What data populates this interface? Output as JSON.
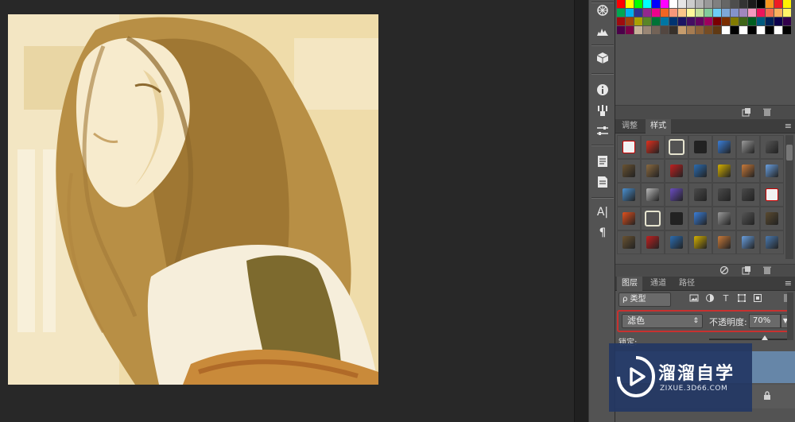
{
  "colors": {
    "app_background": "#282828",
    "panel_background": "#535353",
    "highlight_border": "#c8312f",
    "selected_layer": "#6686a8",
    "watermark_bg": "#233764"
  },
  "toolbar_icons": [
    "color-wheel-icon",
    "histogram-icon",
    "cube-icon",
    "info-icon",
    "brush-icon",
    "sliders-icon",
    "notes-icon",
    "document-icon",
    "character-icon",
    "paragraph-icon"
  ],
  "toolbar_glyphs": {
    "character": "A|",
    "paragraph": "¶"
  },
  "swatches": [
    "#ff0000",
    "#ffff00",
    "#00ff00",
    "#00ffff",
    "#0000ff",
    "#ff00ff",
    "#ffffff",
    "#e6e6e6",
    "#cccccc",
    "#b3b3b3",
    "#999999",
    "#808080",
    "#666666",
    "#4d4d4d",
    "#333333",
    "#1a1a1a",
    "#000000",
    "#f7941d",
    "#ed1c24",
    "#fff200",
    "#00a651",
    "#00aeef",
    "#2e3192",
    "#92278f",
    "#ec008c",
    "#f26522",
    "#f7977a",
    "#fdc689",
    "#fff799",
    "#c4df9b",
    "#82ca9c",
    "#6dcff6",
    "#7ea7d8",
    "#8493ca",
    "#a187be",
    "#f49ac1",
    "#ed145b",
    "#f26c4f",
    "#fbaf5d",
    "#fff568",
    "#9e0b0f",
    "#a0410d",
    "#aba000",
    "#598527",
    "#007236",
    "#0076a3",
    "#003471",
    "#1b1464",
    "#440e62",
    "#630460",
    "#9e005d",
    "#790000",
    "#7b2e00",
    "#827b00",
    "#406618",
    "#005e20",
    "#005b7f",
    "#002157",
    "#0d004c",
    "#32004b",
    "#4b0049",
    "#7b0046",
    "#c7b299",
    "#998675",
    "#736357",
    "#534741",
    "#37302a",
    "#c69c6d",
    "#a67c52",
    "#8c6239",
    "#754c24",
    "#603913",
    "#ffffff",
    "#000000",
    "#ffffff",
    "#000000",
    "#ffffff",
    "#000000",
    "#ffffff",
    "#000000"
  ],
  "styles_panel": {
    "tabs": [
      "调整",
      "样式"
    ],
    "active_tab": "样式",
    "chips": [
      "#f2f2f2",
      "#e0301e",
      "#e6e4cf",
      "#222222",
      "#3a7ed8",
      "#9a9a9a",
      "#555555",
      "#6a5332",
      "#8a6a40",
      "#c02020",
      "#2b6cb0",
      "#d4b000",
      "#c87a3a",
      "#6aa0e0",
      "#4a90d0",
      "#b8b8b8",
      "#6a4cc0",
      "#4a4a4a",
      "#4a4a4a",
      "#4a4a4a",
      "#f2f2f2",
      "#e0501e",
      "#e6e4cf",
      "#222222",
      "#3a7ed8",
      "#9a9a9a",
      "#555555",
      "#5a4a30",
      "#6a5332",
      "#c02020",
      "#2b6cb0",
      "#d4b000",
      "#c87a3a",
      "#6aa0e0",
      "#4a7ab0"
    ]
  },
  "layers_panel": {
    "tabs": [
      "图层",
      "通道",
      "路径"
    ],
    "active_tab": "图层",
    "filter_kind": "ρ 类型",
    "filter_icons_text": [
      "T"
    ],
    "blend_mode": "滤色",
    "opacity_label": "不透明度:",
    "opacity_value": "70%",
    "opacity_fraction": 0.7,
    "lock_label": "锁定:"
  },
  "watermark": {
    "title": "溜溜自学",
    "url": "ZIXUE.3D66.COM"
  }
}
